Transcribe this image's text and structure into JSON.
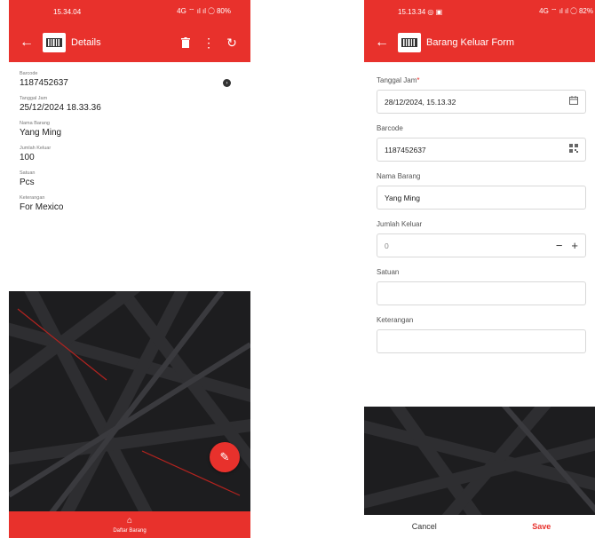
{
  "left": {
    "status": {
      "time": "15.34.04",
      "indicators": "4G ⌔ ıl ıl ◯ 80%"
    },
    "appbar": {
      "title": "Details",
      "icons": [
        "back-icon",
        "logo-icon",
        "delete-icon",
        "more-icon",
        "refresh-icon"
      ]
    },
    "fields": [
      {
        "label": "Barcode",
        "value": "1187452637"
      },
      {
        "label": "Tanggal Jam",
        "value": "25/12/2024 18.33.36"
      },
      {
        "label": "Nama Barang",
        "value": "Yang Ming"
      },
      {
        "label": "Jumlah Keluar",
        "value": "100"
      },
      {
        "label": "Satuan",
        "value": "Pcs"
      },
      {
        "label": "Keterangan",
        "value": "For Mexico"
      }
    ],
    "bottom_nav": {
      "label": "Daftar Barang"
    }
  },
  "right": {
    "status": {
      "time": "15.13.34 ◎ ▣",
      "indicators": "4G ⌔ ıl ıl ◯ 82%"
    },
    "appbar": {
      "title": "Barang Keluar Form"
    },
    "fields": [
      {
        "label": "Tanggal Jam",
        "required": "*",
        "value": "28/12/2024, 15.13.32",
        "trailing_icon": "calendar-icon"
      },
      {
        "label": "Barcode",
        "value": "1187452637",
        "trailing_icon": "qr-scan-icon"
      },
      {
        "label": "Nama Barang",
        "value": "Yang Ming"
      },
      {
        "label": "Jumlah Keluar",
        "value": "0",
        "trailing_icon": "stepper"
      },
      {
        "label": "Satuan",
        "value": ""
      },
      {
        "label": "Keterangan",
        "value": ""
      }
    ],
    "actions": {
      "cancel": "Cancel",
      "save": "Save"
    }
  },
  "colors": {
    "primary": "#e8312c",
    "dark_bg": "#1d1d1f"
  }
}
